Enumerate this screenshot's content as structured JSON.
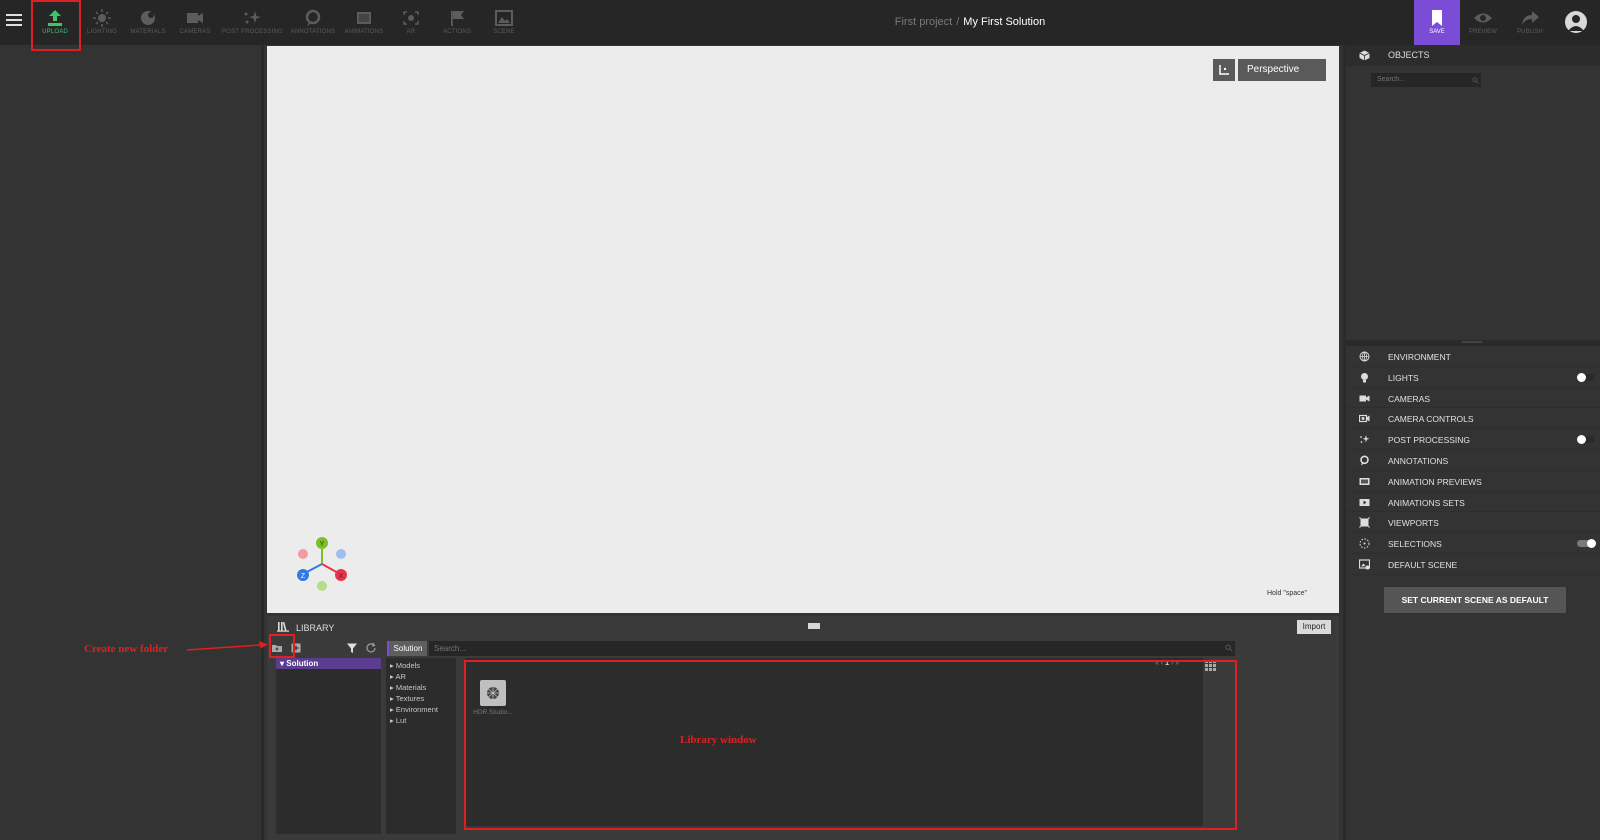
{
  "topbar": {
    "tools": [
      {
        "label": "UPLOAD",
        "icon": "upload-icon",
        "active": true
      },
      {
        "label": "LIGHTING",
        "icon": "sun-icon"
      },
      {
        "label": "MATERIALS",
        "icon": "materials-icon"
      },
      {
        "label": "CAMERAS",
        "icon": "camera-icon"
      },
      {
        "label": "POST PROCESSING",
        "icon": "sparkle-icon"
      },
      {
        "label": "ANNOTATIONS",
        "icon": "annotation-icon"
      },
      {
        "label": "ANIMATIONS",
        "icon": "film-icon"
      },
      {
        "label": "AR",
        "icon": "ar-icon"
      },
      {
        "label": "ACTIONS",
        "icon": "flag-icon"
      },
      {
        "label": "SCENE",
        "icon": "image-icon"
      }
    ],
    "breadcrumb": {
      "project": "First project",
      "separator": "/",
      "solution": "My First Solution"
    },
    "save_label": "SAVE",
    "preview_label": "PREVIEW",
    "publish_label": "PUBLISH",
    "accent_color": "#7b4cd6",
    "active_color": "#3fc46a"
  },
  "viewport": {
    "camera_mode": "Perspective",
    "hint": "Hold \"space\"",
    "gizmo": {
      "y": "Y",
      "x": "X",
      "z": "Z"
    }
  },
  "library": {
    "title": "LIBRARY",
    "import_label": "Import",
    "tab": "Solution",
    "search_placeholder": "Search...",
    "tree": [
      {
        "label": "Solution",
        "expanded": true
      }
    ],
    "categories": [
      "Models",
      "AR",
      "Materials",
      "Textures",
      "Environment",
      "Lut"
    ],
    "page": "1",
    "assets": [
      {
        "name": "HDR Studio..."
      }
    ]
  },
  "annotations": {
    "create_folder": "Create new folder",
    "library_window": "Library window"
  },
  "right_panel": {
    "objects_title": "OBJECTS",
    "search_placeholder": "Search...",
    "items": [
      {
        "label": "ENVIRONMENT",
        "icon": "environment-icon"
      },
      {
        "label": "LIGHTS",
        "icon": "bulb-icon",
        "toggle": "off"
      },
      {
        "label": "CAMERAS",
        "icon": "camera-icon"
      },
      {
        "label": "CAMERA CONTROLS",
        "icon": "camera-control-icon"
      },
      {
        "label": "POST PROCESSING",
        "icon": "sparkle-icon",
        "toggle": "off"
      },
      {
        "label": "ANNOTATIONS",
        "icon": "annotation-icon"
      },
      {
        "label": "ANIMATION PREVIEWS",
        "icon": "film-icon"
      },
      {
        "label": "ANIMATIONS SETS",
        "icon": "animation-set-icon"
      },
      {
        "label": "VIEWPORTS",
        "icon": "viewport-icon"
      },
      {
        "label": "SELECTIONS",
        "icon": "selection-icon",
        "toggle": "on"
      },
      {
        "label": "DEFAULT SCENE",
        "icon": "default-scene-icon"
      }
    ],
    "set_default_label": "SET CURRENT SCENE AS DEFAULT"
  }
}
